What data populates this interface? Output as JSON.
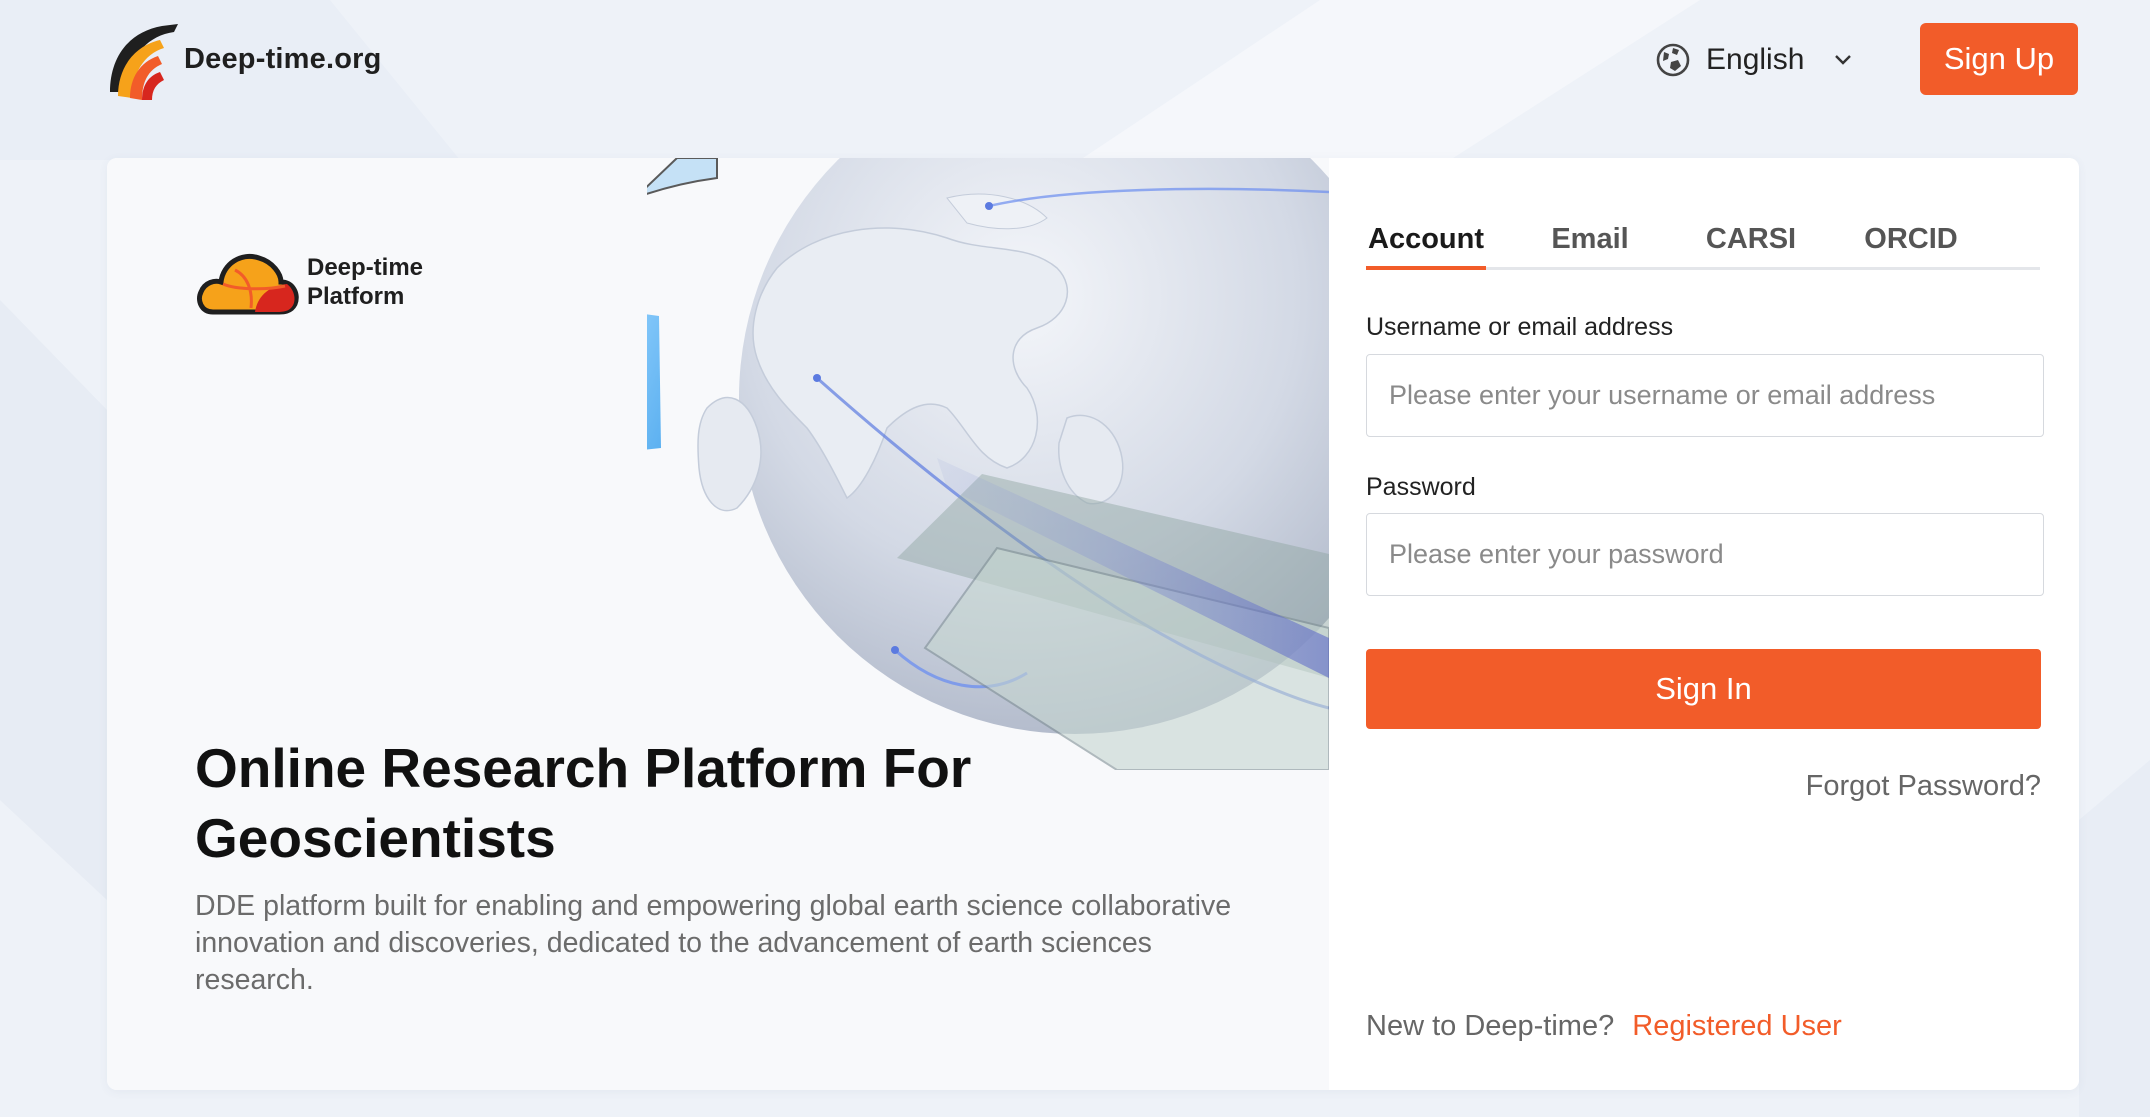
{
  "header": {
    "brand": "Deep-time.org",
    "brand_icon": "deep-time-logo",
    "language": {
      "label": "English",
      "icon": "globe-icon"
    },
    "signup_label": "Sign Up"
  },
  "hero": {
    "platform_name": "Deep-time Platform",
    "title": "Online Research Platform For Geoscientists",
    "description": "DDE platform built for enabling and empowering global earth science collaborative innovation and discoveries, dedicated to the advancement of earth sciences research."
  },
  "login": {
    "tabs": [
      {
        "label": "Account",
        "active": true
      },
      {
        "label": "Email",
        "active": false
      },
      {
        "label": "CARSI",
        "active": false
      },
      {
        "label": "ORCID",
        "active": false
      }
    ],
    "username": {
      "label": "Username or email address",
      "placeholder": "Please enter your username or email address",
      "value": ""
    },
    "password": {
      "label": "Password",
      "placeholder": "Please enter your password",
      "value": ""
    },
    "signin_label": "Sign In",
    "forgot_label": "Forgot Password?",
    "register_prompt": "New to Deep-time?",
    "register_link": "Registered User"
  },
  "colors": {
    "accent": "#f25c29",
    "background": "#eef2f8",
    "panel": "#f8f9fb"
  }
}
